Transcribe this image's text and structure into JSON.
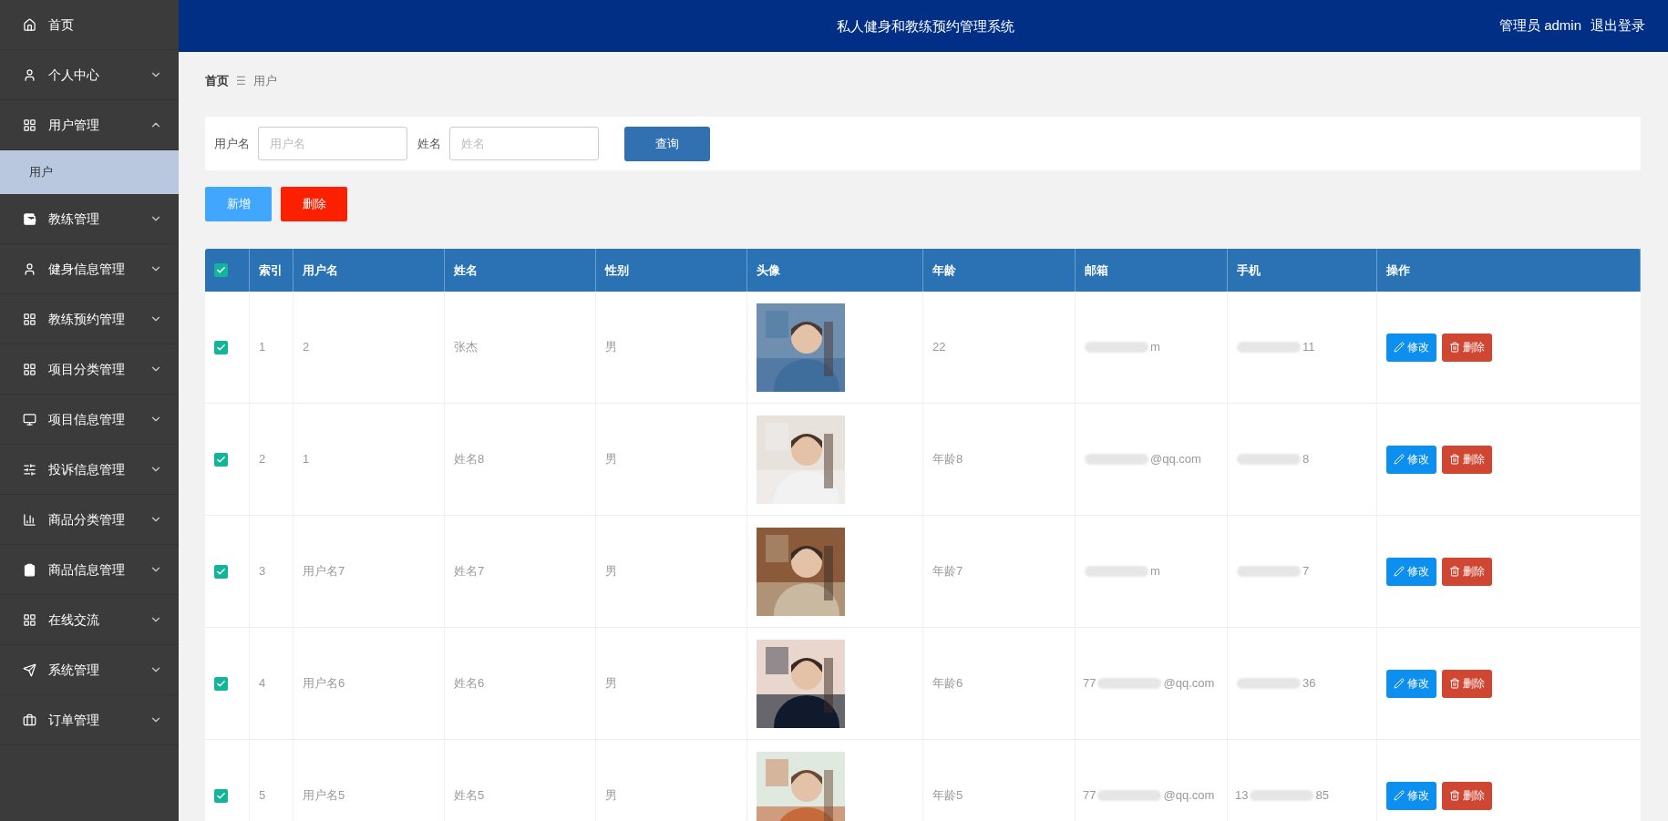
{
  "header": {
    "title": "私人健身和教练预约管理系统",
    "user": "管理员 admin",
    "logout": "退出登录"
  },
  "sidebar": {
    "items": [
      {
        "label": "首页"
      },
      {
        "label": "个人中心",
        "expanded": false
      },
      {
        "label": "用户管理",
        "expanded": true,
        "children": [
          {
            "label": "用户",
            "selected": true
          }
        ]
      },
      {
        "label": "教练管理",
        "expanded": false
      },
      {
        "label": "健身信息管理",
        "expanded": false
      },
      {
        "label": "教练预约管理",
        "expanded": false
      },
      {
        "label": "项目分类管理",
        "expanded": false
      },
      {
        "label": "项目信息管理",
        "expanded": false
      },
      {
        "label": "投诉信息管理",
        "expanded": false
      },
      {
        "label": "商品分类管理",
        "expanded": false
      },
      {
        "label": "商品信息管理",
        "expanded": false
      },
      {
        "label": "在线交流",
        "expanded": false
      },
      {
        "label": "系统管理",
        "expanded": false
      },
      {
        "label": "订单管理",
        "expanded": false
      }
    ]
  },
  "breadcrumb": {
    "items": [
      "首页",
      "用户"
    ],
    "separator": "☰"
  },
  "search": {
    "fields": [
      {
        "label": "用户名",
        "placeholder": "用户名"
      },
      {
        "label": "姓名",
        "placeholder": "姓名"
      }
    ],
    "button": "查询"
  },
  "actions": [
    {
      "label": "新增",
      "kind": "add"
    },
    {
      "label": "删除",
      "kind": "delete"
    }
  ],
  "table": {
    "all_checked": true,
    "columns": [
      "索引",
      "用户名",
      "姓名",
      "性别",
      "头像",
      "年龄",
      "邮箱",
      "手机",
      "操作"
    ],
    "rows": [
      {
        "checked": true,
        "index": "1",
        "username": "2",
        "name": "张杰",
        "gender": "男",
        "avatar": {
          "kind": "picture"
        },
        "age": "22",
        "email": [
          "m"
        ],
        "phone": [
          "11"
        ],
        "actions": [
          "修改",
          "删除"
        ]
      },
      {
        "checked": true,
        "index": "2",
        "username": "1",
        "name": "姓名8",
        "gender": "男",
        "avatar": {
          "kind": "picture"
        },
        "age": "年龄8",
        "email": [
          "@qq.com"
        ],
        "phone": [
          "8"
        ],
        "actions": [
          "修改",
          "删除"
        ]
      },
      {
        "checked": true,
        "index": "3",
        "username": "用户名7",
        "name": "姓名7",
        "gender": "男",
        "avatar": {
          "kind": "picture"
        },
        "age": "年龄7",
        "email": [
          "m"
        ],
        "phone": [
          "7"
        ],
        "actions": [
          "修改",
          "删除"
        ]
      },
      {
        "checked": true,
        "index": "4",
        "username": "用户名6",
        "name": "姓名6",
        "gender": "男",
        "avatar": {
          "kind": "picture"
        },
        "age": "年龄6",
        "email": [
          "77",
          "@qq.com"
        ],
        "phone": [
          "36"
        ],
        "actions": [
          "修改",
          "删除"
        ]
      },
      {
        "checked": true,
        "index": "5",
        "username": "用户名5",
        "name": "姓名5",
        "gender": "男",
        "avatar": {
          "kind": "picture"
        },
        "age": "年龄5",
        "email": [
          "77",
          "@qq.com"
        ],
        "phone": [
          "13",
          "85"
        ],
        "actions": [
          "修改",
          "删除"
        ]
      }
    ]
  }
}
